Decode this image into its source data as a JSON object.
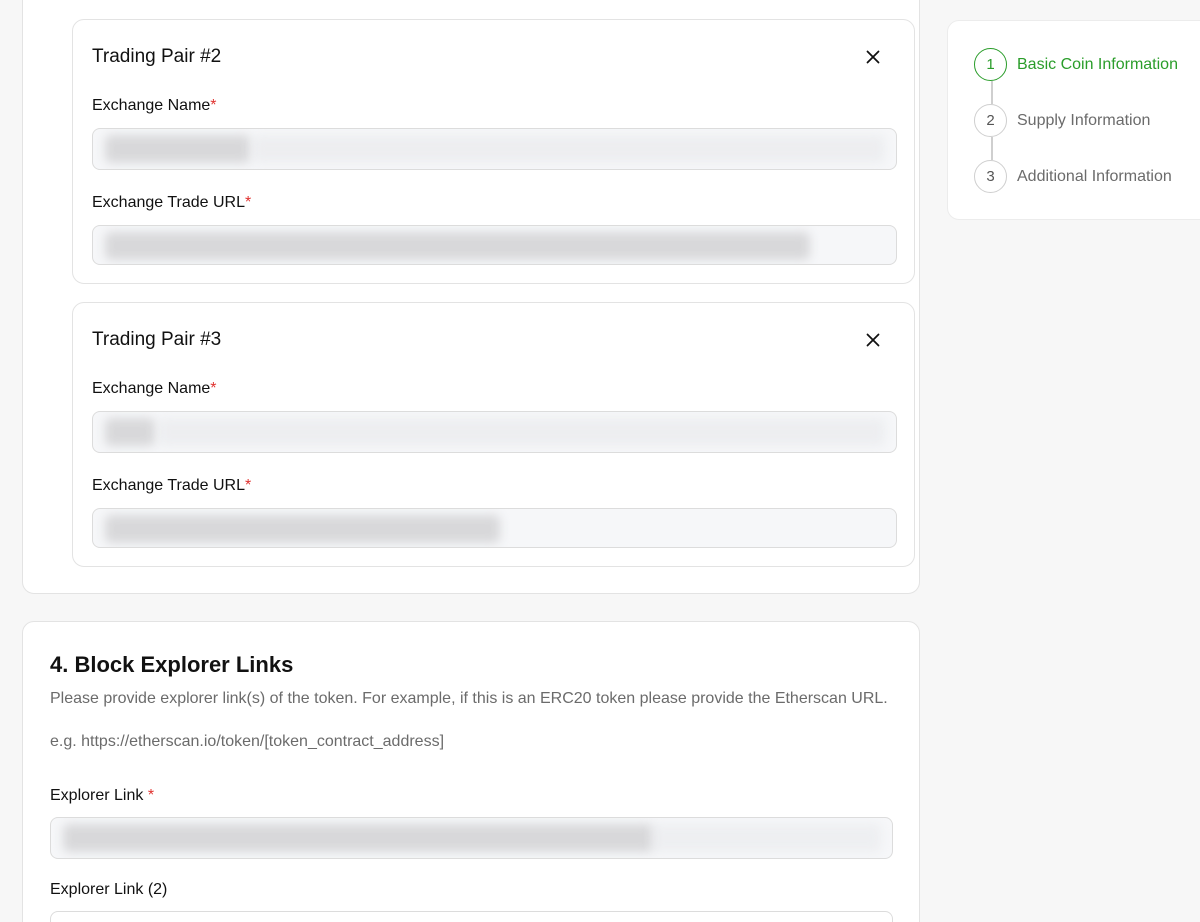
{
  "trading_pairs": [
    {
      "title": "Trading Pair #2",
      "exchange_name_label": "Exchange Name",
      "exchange_url_label": "Exchange Trade URL",
      "required_mark": "*"
    },
    {
      "title": "Trading Pair #3",
      "exchange_name_label": "Exchange Name",
      "exchange_url_label": "Exchange Trade URL",
      "required_mark": "*"
    }
  ],
  "explorer": {
    "title": "4. Block Explorer Links",
    "description": "Please provide explorer link(s) of the token. For example, if this is an ERC20 token please provide the Etherscan URL.",
    "example": "e.g. https://etherscan.io/token/[token_contract_address]",
    "link1_label": "Explorer Link",
    "link2_label": "Explorer Link (2)",
    "required_mark": "*"
  },
  "stepper": {
    "steps": [
      {
        "number": "1",
        "label": "Basic Coin Information",
        "active": true
      },
      {
        "number": "2",
        "label": "Supply Information",
        "active": false
      },
      {
        "number": "3",
        "label": "Additional Information",
        "active": false
      }
    ]
  },
  "colors": {
    "accent_green": "#2a9d2a",
    "required_red": "#e0322f"
  },
  "icons": {
    "close": "close-icon"
  }
}
